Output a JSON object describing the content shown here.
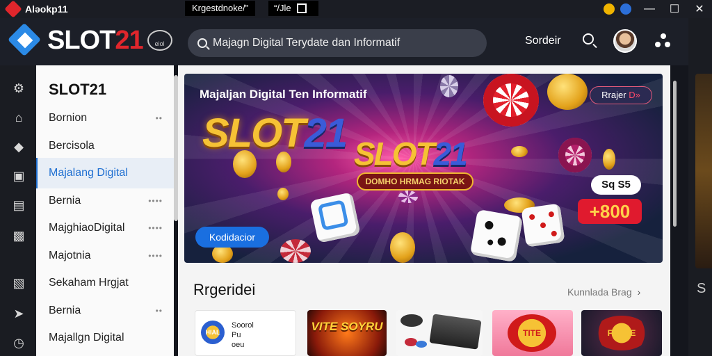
{
  "titlebar": {
    "app_name": "Aləokp11",
    "tab1": "Krgestdnoke/\"",
    "tab2": "“/Jle",
    "controls": [
      "—",
      "☐",
      "✕"
    ]
  },
  "header": {
    "logo_text": "SLOT",
    "logo_num": "21",
    "logo_badge": "eiol",
    "search_value": "Majagn Digital Terydate dan Informatif",
    "link": "Sordeir"
  },
  "rail_icons": [
    "gear-icon",
    "home-icon",
    "shield-icon",
    "inbox-icon",
    "document-icon",
    "clipboard-icon",
    "book-icon",
    "send-icon",
    "clock-icon"
  ],
  "sidebar": {
    "title": "SLOT21",
    "items": [
      {
        "label": "Bornion",
        "dots": "••",
        "active": false
      },
      {
        "label": "Bercisola",
        "dots": "",
        "active": false
      },
      {
        "label": "Majalang Digital",
        "dots": "",
        "active": true
      },
      {
        "label": "Bernia",
        "dots": "••••",
        "active": false
      },
      {
        "label": "MajghiaoDigital",
        "dots": "••••",
        "active": false
      },
      {
        "label": "Majotnia",
        "dots": "••••",
        "active": false
      },
      {
        "label": "Sekaham Hrgjat",
        "dots": "",
        "active": false
      },
      {
        "label": "Bernia",
        "dots": "••",
        "active": false
      },
      {
        "label": "Majallgn Digital",
        "dots": "",
        "active": false
      }
    ]
  },
  "banner": {
    "tagline": "Majaljan Digital Ten Informatif",
    "logo_text": "SLOT",
    "logo_num": "21",
    "ribbon": "DOMHO HRMAG RIOTAK",
    "cta": "Kodidacior",
    "pill_text": "Rrajer",
    "pill_accent": "D»",
    "label1": "Sq S5",
    "label2": "+800"
  },
  "section": {
    "title": "Rrgeridei",
    "link": "Kunnlada Brag",
    "cards": [
      {
        "text": "Soorol",
        "sub": "Pu",
        "sub2": "HIAL",
        "extra": "oeu"
      },
      {
        "text": "VITE SOYRU"
      },
      {
        "text": ""
      },
      {
        "text": "TITE"
      },
      {
        "text": "FOTRE"
      }
    ]
  },
  "right_strip": {
    "letter": "S"
  },
  "colors": {
    "accent": "#1f6fd1",
    "brand_red": "#e0262c",
    "gold": "#f6c235"
  }
}
